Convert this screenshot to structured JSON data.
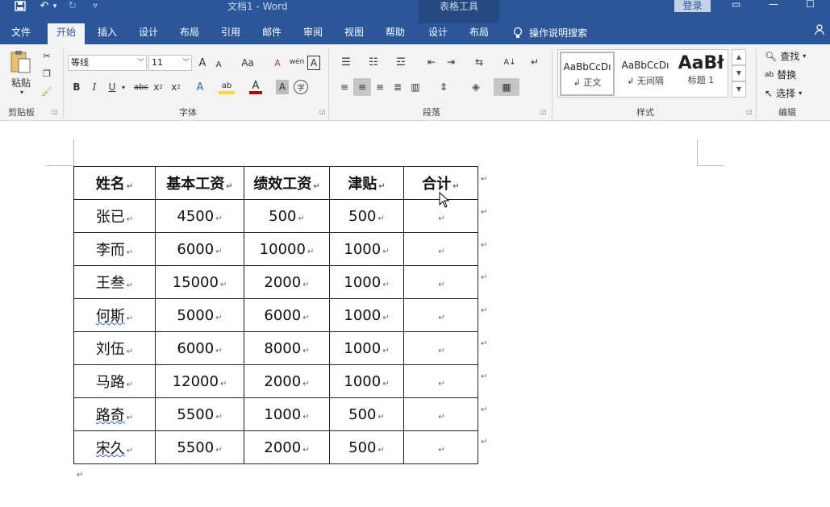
{
  "titlebar": {
    "doc_title": "文档1  -  Word",
    "tools_title": "表格工具",
    "login": "登录",
    "qat": {
      "save": "save-icon",
      "undo": "↶",
      "undo_caret": "▾",
      "redo": "↻",
      "customize": "▿"
    },
    "window": {
      "ribbon_options": "▭",
      "minimize": "—",
      "restore": "☐"
    }
  },
  "tabs": [
    {
      "label": "文件",
      "active": false
    },
    {
      "label": "开始",
      "active": true
    },
    {
      "label": "插入",
      "active": false
    },
    {
      "label": "设计",
      "active": false
    },
    {
      "label": "布局",
      "active": false
    },
    {
      "label": "引用",
      "active": false
    },
    {
      "label": "邮件",
      "active": false
    },
    {
      "label": "审阅",
      "active": false
    },
    {
      "label": "视图",
      "active": false
    },
    {
      "label": "帮助",
      "active": false
    },
    {
      "label": "设计",
      "active": false
    },
    {
      "label": "布局",
      "active": false
    }
  ],
  "tell_me": "操作说明搜索",
  "ribbon": {
    "clipboard": {
      "paste": "粘贴",
      "label": "剪贴板"
    },
    "font": {
      "name": "等线",
      "size": "11",
      "grow": "A",
      "shrink": "A",
      "case": "Aa",
      "clear": "A",
      "phonetic": "wén",
      "border_char": "A",
      "bold": "B",
      "italic": "I",
      "underline": "U",
      "strike": "abc",
      "sub": "x",
      "sup": "x",
      "effect": "A",
      "highlight": "ab",
      "color": "A",
      "shade": "A",
      "enclose": "字",
      "label": "字体"
    },
    "paragraph": {
      "label": "段落",
      "sort": "A↓",
      "marks": "↵"
    },
    "styles": {
      "label": "样式",
      "items": [
        {
          "preview": "AaBbCcDı",
          "name": "↲ 正文"
        },
        {
          "preview": "AaBbCcDı",
          "name": "↲ 无间隔"
        },
        {
          "preview": "AaBł",
          "name": "标题 1"
        }
      ]
    },
    "editing": {
      "find": "查找",
      "replace": "替换",
      "select": "选择",
      "label": "编辑"
    }
  },
  "table": {
    "headers": [
      "姓名",
      "基本工资",
      "绩效工资",
      "津贴",
      "合计"
    ],
    "rows": [
      [
        "张已",
        "4500",
        "500",
        "500",
        ""
      ],
      [
        "李而",
        "6000",
        "10000",
        "1000",
        ""
      ],
      [
        "王叁",
        "15000",
        "2000",
        "1000",
        ""
      ],
      [
        "何斯",
        "5000",
        "6000",
        "1000",
        ""
      ],
      [
        "刘伍",
        "6000",
        "8000",
        "1000",
        ""
      ],
      [
        "马路",
        "12000",
        "2000",
        "1000",
        ""
      ],
      [
        "路奇",
        "5500",
        "1000",
        "500",
        ""
      ],
      [
        "宋久",
        "5500",
        "2000",
        "500",
        ""
      ]
    ],
    "cell_mark": "↵",
    "row_mark": "↵"
  },
  "paragraph_mark": "↵"
}
